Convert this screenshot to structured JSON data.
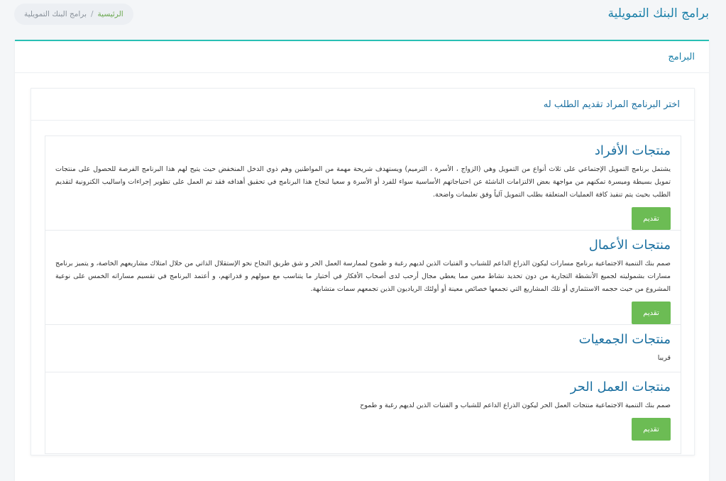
{
  "header": {
    "title": "برامج البنك التمويلية",
    "breadcrumb": {
      "home": "الرئيسية",
      "separator": "/",
      "current": "برامج البنك التمويلية"
    }
  },
  "outer": {
    "title": "البرامج"
  },
  "inner": {
    "title": "اختر البرنامج المراد تقديم الطلب له"
  },
  "programs": [
    {
      "title": "منتجات الأفراد",
      "description": "يشتمل برنامج التمويل الإجتماعي على ثلاث أنواع من التمويل وهي (الزواج ، الأسرة ، الترميم) ويستهدف شريحة مهمة من المواطنين وهم ذوي الدخل المنخفض حيث يتيح لهم هذا البرنامج الفرصة للحصول على منتجات تمويل بسيطة وميسرة تمكنهم من مواجهة بعض الالتزامات الناشئة عن احتياجاتهم الأساسية سواء للفرد أو الأسرة و سعيا لنجاح هذا البرنامج في تحقيق أهدافه فقد تم العمل على تطوير إجراءات واساليب الكترونية لتقديم الطلب بحيث يتم تنفيذ كافة العمليات المتعلقة بطلب التمويل آلياً وفق تعليمات واضحة.",
      "button": "تقديم"
    },
    {
      "title": "منتجات الأعمال",
      "description": "صمم بنك التنمية الاجتماعية برنامج مسارات ليكون الذراع الداعم للشباب و الفتيات الذين لديهم رغبة و طموح لممارسة العمل الحر و شق طريق النجاح نحو الإستقلال الذاتي من خلال امتلاك مشاريعهم الخاصة، و يتميز برنامج مسارات بشموليته لجميع الأنشطة التجارية من دون تحديد نشاط معين مما يعطي مجال أرحب لدى أصحاب الأفكار في أختيار ما يتناسب مع ميولهم و قدراتهم، و أعتمد البرنامج في تقسيم مساراته الخمس على نوعية المشروع من حيث حجمه الاستثماري أو تلك المشاريع التي تجمعها خصائص معينة أو أولئك الرياديون الذين تجمعهم سمات متشابهة.",
      "button": "تقديم"
    },
    {
      "title": "منتجات الجمعيات",
      "description": "قريبا",
      "button": ""
    },
    {
      "title": "منتجات العمل الحر",
      "description": "صمم بنك التنمية الاجتماعية منتجات العمل الحر ليكون الذراع الداعم للشباب و الفتيات الذين لديهم رغبة و طموح",
      "button": "تقديم"
    }
  ]
}
